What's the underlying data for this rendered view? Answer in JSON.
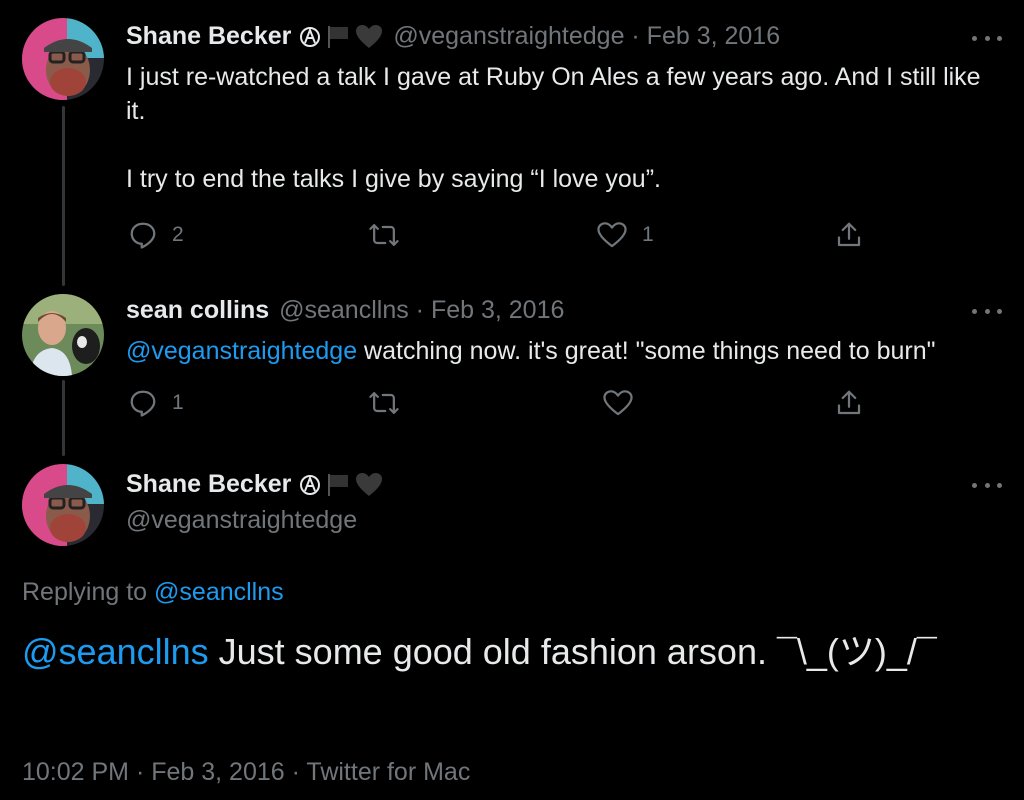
{
  "tweets": [
    {
      "author_name": "Shane Becker",
      "handle_meta": "@veganstraightedge · Feb 3, 2016",
      "text_lines": [
        "I just re-watched a talk I gave at Ruby On Ales a few years ago. And I still like it.",
        "I try to end the talks I give by saying “I love you”."
      ],
      "reply_count": "2",
      "retweet_count": "",
      "like_count": "1"
    },
    {
      "author_name": "sean collins",
      "handle_meta": "@seancllns · Feb 3, 2016",
      "mention": "@veganstraightedge",
      "text": " watching now. it's great! \"some things need to burn\"",
      "reply_count": "1",
      "retweet_count": "",
      "like_count": ""
    }
  ],
  "main_tweet": {
    "author_name": "Shane Becker",
    "handle": "@veganstraightedge",
    "replying_prefix": "Replying to ",
    "replying_to": "@seancllns",
    "mention": "@seancllns",
    "text": " Just some good old fashion arson. ¯\\_(ツ)_/¯",
    "timestamp": "10:02 PM · Feb 3, 2016 · Twitter for Mac"
  },
  "icons": {
    "reply": "reply-icon",
    "retweet": "retweet-icon",
    "like": "heart-icon",
    "share": "share-icon",
    "more": "more-icon"
  },
  "colors": {
    "background": "#000000",
    "text": "#e7e9ea",
    "muted": "#71767b",
    "link": "#1d9bf0",
    "thread_line": "#333639"
  }
}
